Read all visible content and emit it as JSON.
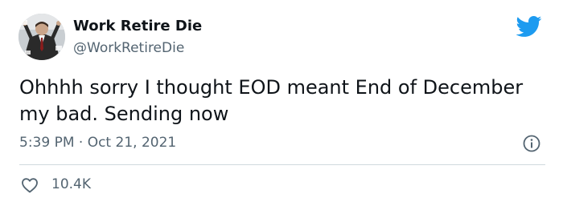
{
  "author": {
    "name": "Work Retire Die",
    "handle": "@WorkRetireDie"
  },
  "tweet": {
    "text": "Ohhhh sorry I thought EOD meant End of December my bad. Sending now",
    "timestamp": "5:39 PM · Oct 21, 2021"
  },
  "engagement": {
    "likes": "10.4K"
  },
  "icons": {
    "brand": "twitter-bird-icon",
    "info": "info-icon",
    "like": "heart-icon"
  },
  "colors": {
    "brand": "#1d9bf0",
    "text": "#0f1419",
    "secondary": "#536471",
    "divider": "#cfd9de"
  }
}
